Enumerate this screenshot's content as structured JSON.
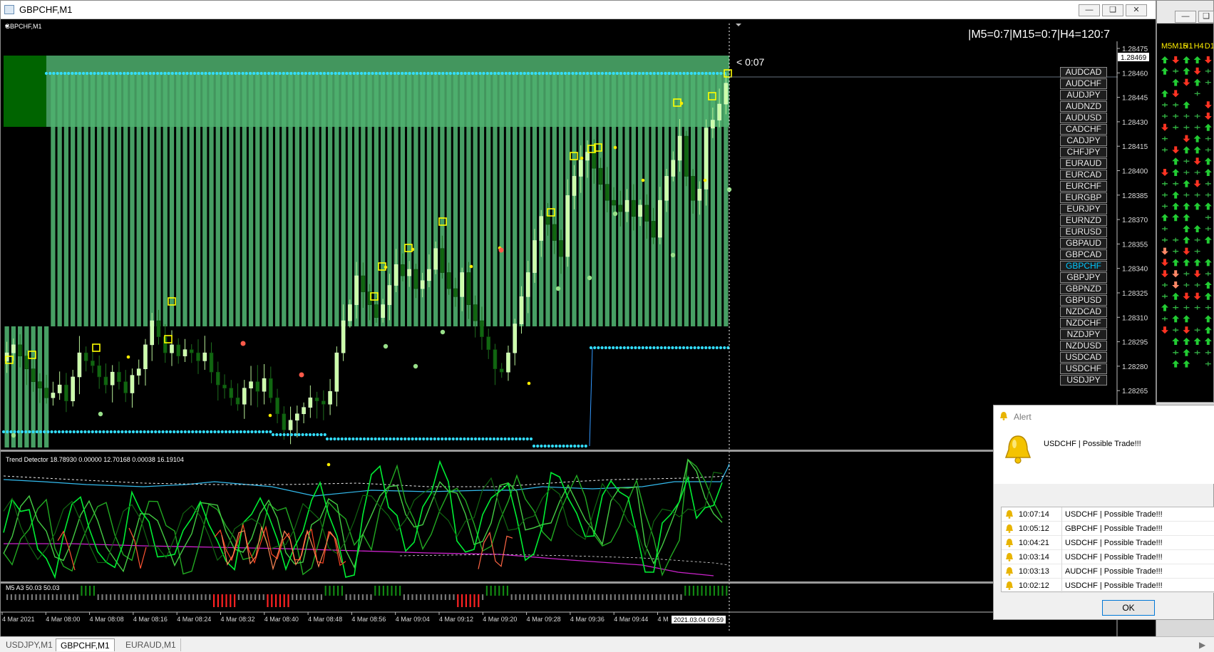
{
  "main_window": {
    "title": "GBPCHF,M1"
  },
  "chart": {
    "symbol_label": "GBPCHF,M1",
    "mtf_info": "|M5=0:7|M15=0:7|H4=120:7",
    "countdown": "< 0:07",
    "current_price": "1.28469",
    "price_ticks": [
      "1.28475",
      "1.28460",
      "1.28445",
      "1.28430",
      "1.28415",
      "1.28400",
      "1.28385",
      "1.28370",
      "1.28355",
      "1.28340",
      "1.28325",
      "1.28310",
      "1.28295",
      "1.28280",
      "1.28265"
    ]
  },
  "pairs": [
    "AUDCAD",
    "AUDCHF",
    "AUDJPY",
    "AUDNZD",
    "AUDUSD",
    "CADCHF",
    "CADJPY",
    "CHFJPY",
    "EURAUD",
    "EURCAD",
    "EURCHF",
    "EURGBP",
    "EURJPY",
    "EURNZD",
    "EURUSD",
    "GBPAUD",
    "GBPCAD",
    "GBPCHF",
    "GBPJPY",
    "GBPNZD",
    "GBPUSD",
    "NZDCAD",
    "NZDCHF",
    "NZDJPY",
    "NZDUSD",
    "USDCAD",
    "USDCHF",
    "USDJPY"
  ],
  "active_pair": "GBPCHF",
  "indicator1": {
    "label": "Trend Detector 18.78930 0.00000 12.70168 0.00038 16.19104"
  },
  "indicator2": {
    "label": "M5 A3 50.03 50.03"
  },
  "time_axis": [
    "4 Mar 2021",
    "4 Mar 08:00",
    "4 Mar 08:08",
    "4 Mar 08:16",
    "4 Mar 08:24",
    "4 Mar 08:32",
    "4 Mar 08:40",
    "4 Mar 08:48",
    "4 Mar 08:56",
    "4 Mar 09:04",
    "4 Mar 09:12",
    "4 Mar 09:20",
    "4 Mar 09:28",
    "4 Mar 09:36",
    "4 Mar 09:44",
    "4 M"
  ],
  "time_cursor": "2021.03.04 09:59",
  "mtf_panel": {
    "headers": [
      "M5",
      "M15",
      "H1",
      "H4",
      "D1"
    ]
  },
  "alert": {
    "title": "Alert",
    "message": "USDCHF | Possible Trade!!!",
    "rows": [
      {
        "time": "10:07:14",
        "message": "USDCHF | Possible Trade!!!"
      },
      {
        "time": "10:05:12",
        "message": "GBPCHF | Possible Trade!!!"
      },
      {
        "time": "10:04:21",
        "message": "USDCHF | Possible Trade!!!"
      },
      {
        "time": "10:03:14",
        "message": "USDCHF | Possible Trade!!!"
      },
      {
        "time": "10:03:13",
        "message": "AUDCHF | Possible Trade!!!"
      },
      {
        "time": "10:02:12",
        "message": "USDCHF | Possible Trade!!!"
      }
    ],
    "ok_label": "OK"
  },
  "tabs": [
    "USDJPY,M1",
    "GBPCHF,M1",
    "EURAUD,M1"
  ],
  "active_tab": "GBPCHF,M1",
  "colors": {
    "bull": "#ccffaa",
    "bear": "#116611",
    "zone": "#4fb06f",
    "dots": "#33ddff",
    "signal_box": "#ffff00"
  }
}
